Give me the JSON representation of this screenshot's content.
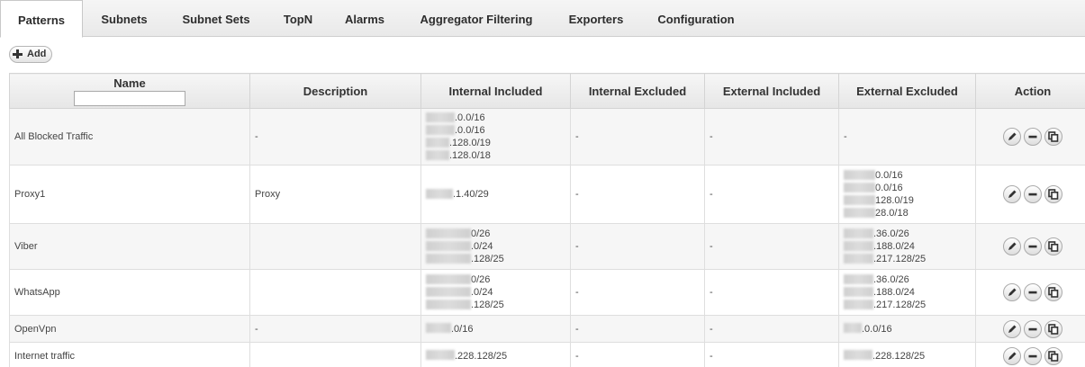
{
  "tabs": [
    {
      "label": "Patterns",
      "active": true
    },
    {
      "label": "Subnets"
    },
    {
      "label": "Subnet Sets"
    },
    {
      "label": "TopN"
    },
    {
      "label": "Alarms"
    },
    {
      "label": "Aggregator Filtering"
    },
    {
      "label": "Exporters"
    },
    {
      "label": "Configuration"
    }
  ],
  "toolbar": {
    "add_label": "Add",
    "add_icon": "plus-icon"
  },
  "table": {
    "headers": {
      "name": "Name",
      "description": "Description",
      "internal_included": "Internal Included",
      "internal_excluded": "Internal Excluded",
      "external_included": "External Included",
      "external_excluded": "External Excluded",
      "action": "Action"
    },
    "name_filter": {
      "value": "",
      "placeholder": ""
    },
    "rows": [
      {
        "name": "All Blocked Traffic",
        "description": "-",
        "internal_included": [
          ".0.0/16",
          ".0.0/16",
          ".128.0/19",
          ".128.0/18"
        ],
        "internal_excluded": "-",
        "external_included": "-",
        "external_excluded_text": "-"
      },
      {
        "name": "Proxy1",
        "description": "Proxy",
        "internal_included": [
          ".1.40/29"
        ],
        "internal_excluded": "-",
        "external_included": "-",
        "external_excluded": [
          "0.0/16",
          "0.0/16",
          "128.0/19",
          "28.0/18"
        ]
      },
      {
        "name": "Viber",
        "description": "",
        "internal_included": [
          "0/26",
          ".0/24",
          ".128/25"
        ],
        "internal_excluded": "-",
        "external_included": "-",
        "external_excluded": [
          ".36.0/26",
          ".188.0/24",
          ".217.128/25"
        ]
      },
      {
        "name": "WhatsApp",
        "description": "",
        "internal_included": [
          "0/26",
          ".0/24",
          ".128/25"
        ],
        "internal_excluded": "-",
        "external_included": "-",
        "external_excluded": [
          ".36.0/26",
          ".188.0/24",
          ".217.128/25"
        ]
      },
      {
        "name": "OpenVpn",
        "description": "-",
        "internal_included": [
          ".0/16"
        ],
        "internal_excluded": "-",
        "external_included": "-",
        "external_excluded": [
          ".0.0/16"
        ]
      },
      {
        "name": "Internet traffic",
        "description": "",
        "internal_included": [
          ".228.128/25"
        ],
        "internal_excluded": "-",
        "external_included": "-",
        "external_excluded": [
          ".228.128/25"
        ]
      }
    ],
    "action_icons": [
      "edit-icon",
      "delete-icon",
      "copy-icon"
    ]
  },
  "colors": {
    "header_bg": "#ececec",
    "row_alt_bg": "#f6f6f6",
    "border": "#d4d4d4",
    "text": "#444444"
  }
}
